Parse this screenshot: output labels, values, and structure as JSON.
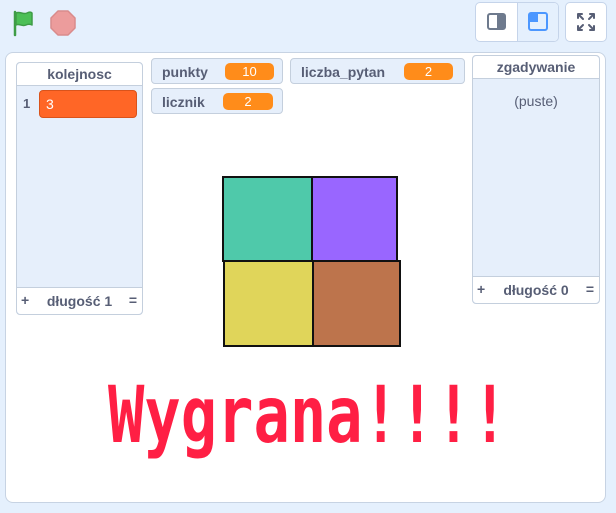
{
  "controls": {
    "green_flag_icon": "green-flag-icon",
    "stop_icon": "stop-icon",
    "small_stage_icon": "small-stage-icon",
    "normal_stage_icon": "normal-stage-icon",
    "fullscreen_icon": "fullscreen-icon"
  },
  "monitors": {
    "kolejnosc": {
      "label": "kolejnosc",
      "items": [
        {
          "index": "1",
          "value": "3"
        }
      ],
      "add_symbol": "+",
      "length_label": "długość 1",
      "resize_symbol": "="
    },
    "zgadywanie": {
      "label": "zgadywanie",
      "empty_text": "(puste)",
      "add_symbol": "+",
      "length_label": "długość 0",
      "resize_symbol": "="
    },
    "punkty": {
      "label": "punkty",
      "value": "10"
    },
    "liczba_pytan": {
      "label": "liczba_pytan",
      "value": "2"
    },
    "licznik": {
      "label": "licznik",
      "value": "2"
    }
  },
  "stage": {
    "message": "Wygrana!!!!",
    "message_color": "#ff1f44",
    "square_colors": {
      "top_left": "#4fc9aa",
      "top_right": "#9966ff",
      "bottom_left": "#e0d55a",
      "bottom_right": "#bd744c"
    }
  },
  "colors": {
    "list_item": "#ff6626",
    "variable_value": "#ff8c1a",
    "flag": "#4cbf56",
    "stop": "#ec9c9c"
  }
}
